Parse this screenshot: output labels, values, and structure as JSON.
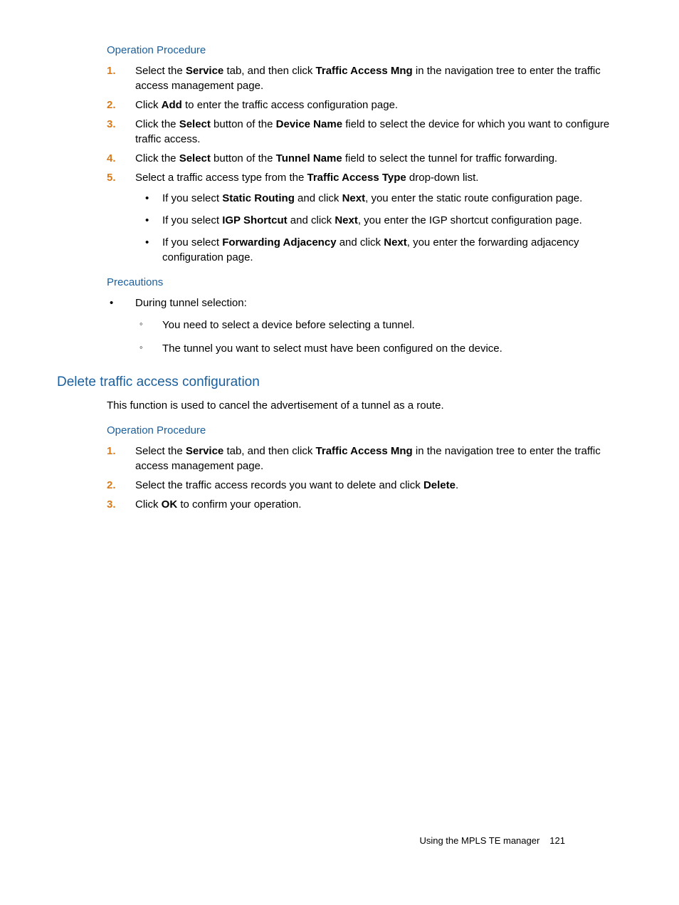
{
  "headings": {
    "opProc1": "Operation Procedure",
    "precautions": "Precautions",
    "deleteSection": "Delete traffic access configuration",
    "opProc2": "Operation Procedure"
  },
  "steps1": {
    "s1a": "Select the ",
    "s1b": "Service",
    "s1c": " tab, and then click ",
    "s1d": "Traffic Access Mng",
    "s1e": " in the navigation tree to enter the traffic access management page.",
    "s2a": "Click ",
    "s2b": "Add",
    "s2c": " to enter the traffic access configuration page.",
    "s3a": "Click the ",
    "s3b": "Select",
    "s3c": " button of the ",
    "s3d": "Device Name",
    "s3e": " field to select the device for which you want to configure traffic access.",
    "s4a": "Click the ",
    "s4b": "Select",
    "s4c": " button of the ",
    "s4d": "Tunnel Name",
    "s4e": " field to select the tunnel for traffic forwarding.",
    "s5a": "Select a traffic access type from the ",
    "s5b": "Traffic Access Type",
    "s5c": " drop-down list."
  },
  "bullets1": {
    "b1a": "If you select ",
    "b1b": "Static Routing",
    "b1c": " and click ",
    "b1d": "Next",
    "b1e": ", you enter the static route configuration page.",
    "b2a": "If you select ",
    "b2b": "IGP Shortcut",
    "b2c": " and click ",
    "b2d": "Next",
    "b2e": ", you enter the IGP shortcut configuration page.",
    "b3a": "If you select ",
    "b3b": "Forwarding Adjacency",
    "b3c": " and click ",
    "b3d": "Next",
    "b3e": ", you enter the forwarding adjacency configuration page."
  },
  "precautions": {
    "p1": "During tunnel selection:",
    "c1": "You need to select a device before selecting a tunnel.",
    "c2": "The tunnel you want to select must have been configured on the device."
  },
  "deleteIntro": "This function is used to cancel the advertisement of a tunnel as a route.",
  "steps2": {
    "s1a": "Select the ",
    "s1b": "Service",
    "s1c": " tab, and then click ",
    "s1d": "Traffic Access Mng",
    "s1e": " in the navigation tree to enter the traffic access management page.",
    "s2a": "Select the traffic access records you want to delete and click ",
    "s2b": "Delete",
    "s2c": ".",
    "s3a": "Click ",
    "s3b": "OK",
    "s3c": " to confirm your operation."
  },
  "nums": {
    "n1": "1.",
    "n2": "2.",
    "n3": "3.",
    "n4": "4.",
    "n5": "5."
  },
  "footer": {
    "text": "Using the MPLS TE manager",
    "page": "121"
  }
}
